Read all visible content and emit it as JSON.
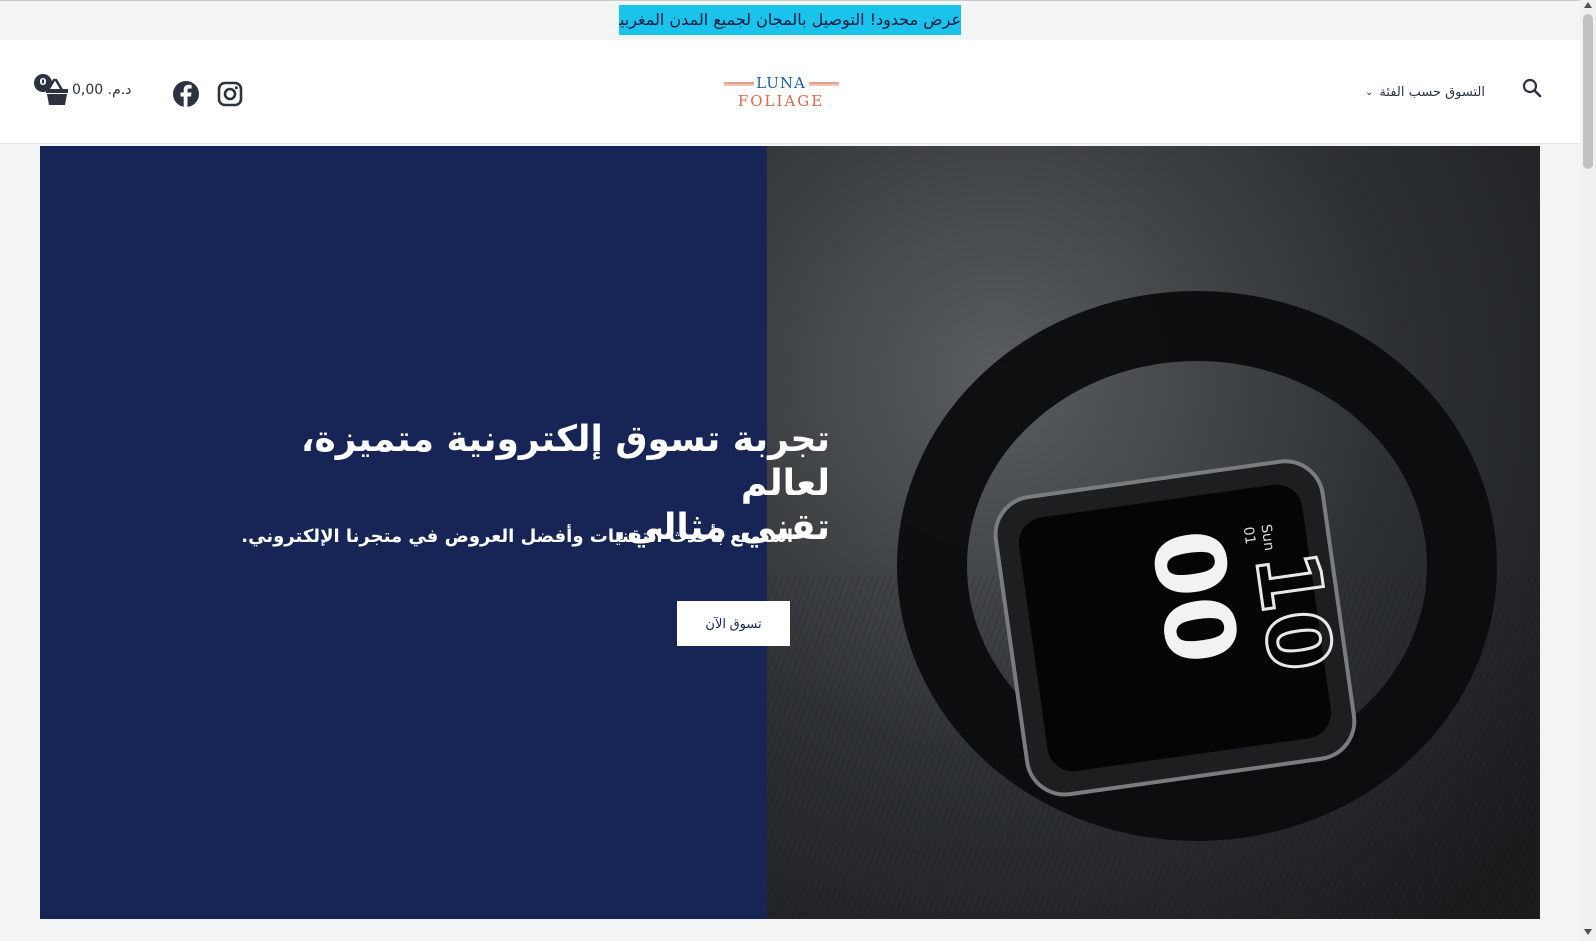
{
  "announcement": {
    "text": "عرض محدود! التوصيل بالمجان لجميع المدن المغربية"
  },
  "header": {
    "logo": {
      "line1": "LUNA",
      "line2": "FOLIAGE"
    },
    "nav": {
      "category_label": "التسوق حسب الفئة"
    },
    "cart": {
      "count": "0",
      "total": "د.م. 0,00"
    },
    "icons": {
      "search": "search-icon",
      "cart": "shopping-basket-icon",
      "facebook": "facebook-icon",
      "instagram": "instagram-icon",
      "dropdown": "chevron-down-icon"
    }
  },
  "hero": {
    "title_line1": "تجربة تسوق إلكترونية متميزة، لعالم",
    "title_line2": "تقني مثالي.",
    "subtitle": "استمتع بأحدث التقنيات وأفضل العروض في متجرنا الإلكتروني.",
    "cta_label": "تسوق الآن",
    "image": {
      "watch_date_day": "Sun",
      "watch_date_num": "01",
      "watch_hour": "10",
      "watch_minute": "00"
    }
  },
  "colors": {
    "promo_bg": "#19c3ec",
    "hero_left_bg": "#172556",
    "logo_blue": "#1f5fa8",
    "logo_red": "#d9694c"
  }
}
